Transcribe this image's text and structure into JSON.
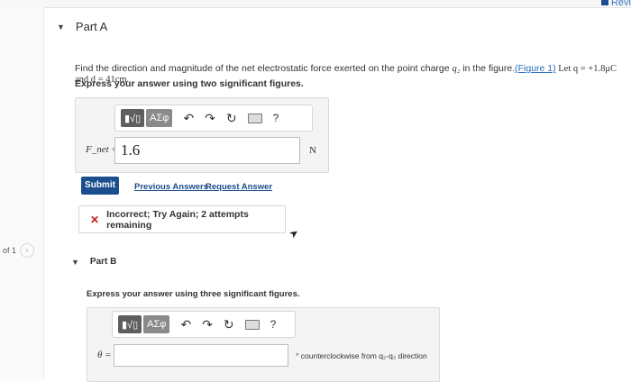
{
  "header": {
    "review_label": "Revi"
  },
  "pager": {
    "position": "of 1",
    "next": "›"
  },
  "part_a": {
    "caret": "▼",
    "title": "Part A",
    "question": {
      "before_charge": "Find the direction and magnitude of the net electrostatic force exerted on the point charge ",
      "charge": "q₂",
      "after_charge": " in the figure.",
      "figure_link": "(Figure 1)",
      "given": " Let q = +1.8μC and d = 41cm."
    },
    "instruction": "Express your answer using two significant figures.",
    "toolbar": {
      "templates": "▮√▯",
      "symbols": "ΑΣφ",
      "undo": "↶",
      "redo": "↷",
      "reset": "↻",
      "help": "?"
    },
    "variable": "F_net =",
    "answer": "1.6",
    "unit": "N",
    "submit": "Submit",
    "previous_answers": "Previous Answers",
    "request_answer": "Request Answer",
    "feedback": {
      "icon": "✕",
      "text": "Incorrect; Try Again; 2 attempts remaining"
    }
  },
  "part_b": {
    "caret": "▼",
    "title": "Part B",
    "instruction": "Express your answer using three significant figures.",
    "toolbar": {
      "templates": "▮√▯",
      "symbols": "ΑΣφ",
      "undo": "↶",
      "redo": "↷",
      "reset": "↻",
      "help": "?"
    },
    "variable": "θ =",
    "answer": "",
    "unit": "° counterclockwise from q₂-q₃ direction"
  }
}
